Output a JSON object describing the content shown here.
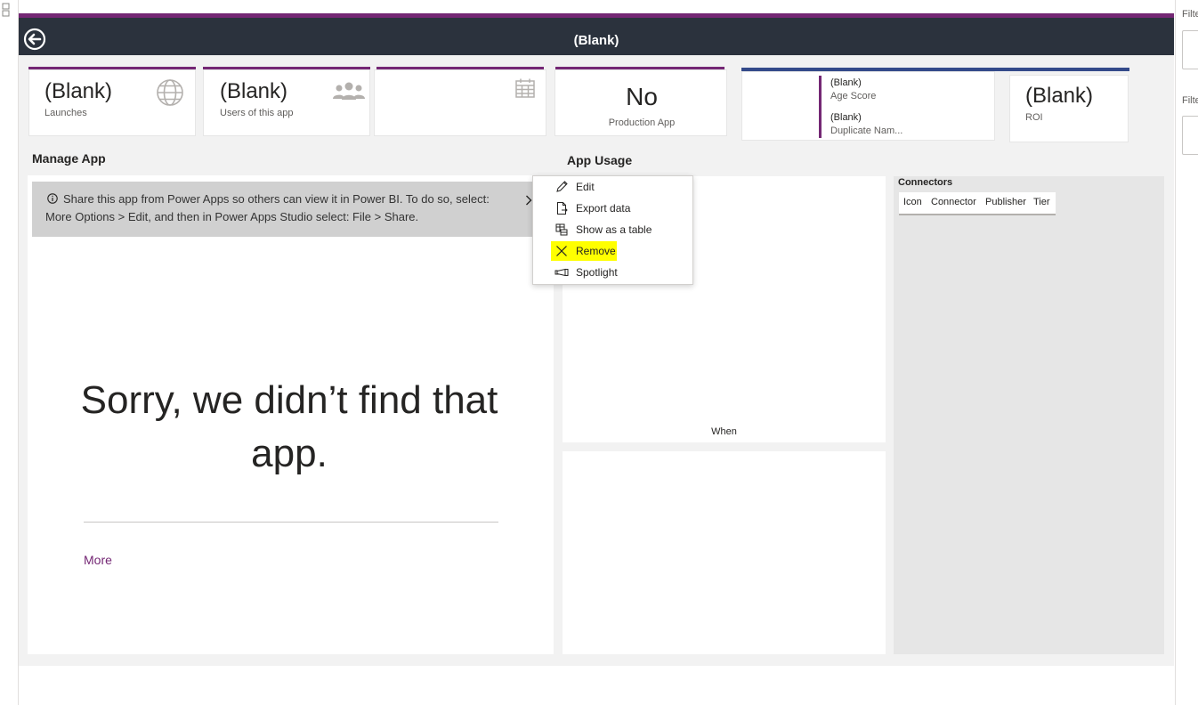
{
  "header": {
    "title": "(Blank)"
  },
  "kpis": [
    {
      "value": "(Blank)",
      "label": "Launches",
      "icon": "globe-icon"
    },
    {
      "value": "(Blank)",
      "label": "Users of this app",
      "icon": "users-icon"
    },
    {
      "value": "",
      "label": "",
      "icon": "calendar-icon"
    },
    {
      "value": "No",
      "label": "Production App"
    }
  ],
  "multi_card": {
    "rows": [
      {
        "value": "(Blank)",
        "label": "Age Score"
      },
      {
        "value": "(Blank)",
        "label": "Duplicate Nam..."
      }
    ]
  },
  "roi": {
    "value": "(Blank)",
    "label": "ROI"
  },
  "manage_app": {
    "title": "Manage App",
    "info_text": "Share this app from Power Apps so others can view it in Power BI. To do so, select: More Options > Edit, and then in Power Apps Studio select: File > Share.",
    "sorry_text": "Sorry, we didn’t find that app.",
    "more_link": "More"
  },
  "app_usage": {
    "title": "App Usage",
    "axis_label": "When"
  },
  "context_menu": {
    "items": [
      {
        "label": "Edit",
        "icon": "pencil-icon"
      },
      {
        "label": "Export data",
        "icon": "export-icon"
      },
      {
        "label": "Show as a table",
        "icon": "table-icon"
      },
      {
        "label": "Remove",
        "icon": "close-icon",
        "highlighted": true
      },
      {
        "label": "Spotlight",
        "icon": "spotlight-icon"
      }
    ]
  },
  "connectors": {
    "title": "Connectors",
    "columns": [
      "Icon",
      "Connector",
      "Publisher",
      "Tier"
    ]
  },
  "filters_pane": {
    "label_1": "Filte",
    "label_2": "Filte"
  },
  "colors": {
    "accent": "#742774",
    "topbar": "#2b323d",
    "blue_accent": "#344a8a",
    "highlight": "#ffff00"
  }
}
